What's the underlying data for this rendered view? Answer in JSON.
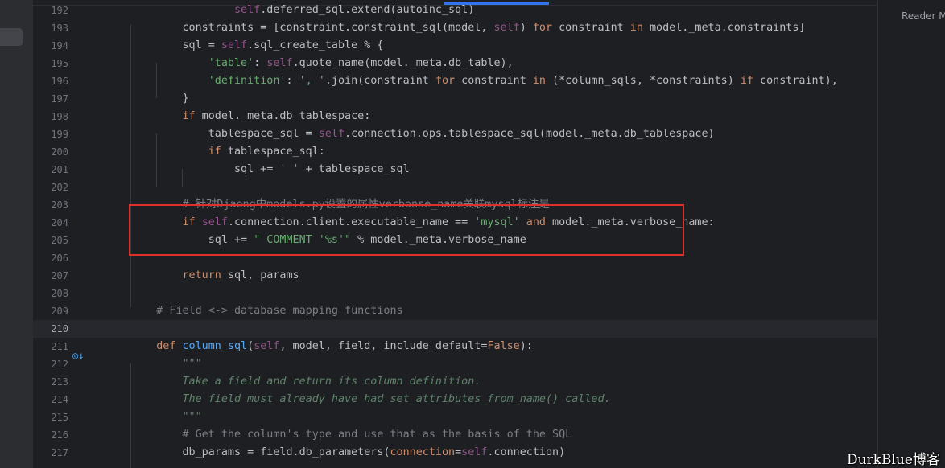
{
  "right_panel": {
    "reader_mode_label": "Reader M"
  },
  "watermark": "DurkBlue博客",
  "colors": {
    "keyword": "#cf8e6d",
    "self": "#94558d",
    "string": "#6aab73",
    "comment": "#7a7e85",
    "docstring": "#5f826b",
    "function": "#56a8f5",
    "highlight_border": "#e0302c"
  },
  "gutter_icon": "override-method-icon",
  "editor": {
    "current_line": 210,
    "lines": [
      {
        "n": "192",
        "segs": [
          [
            "",
            "                "
          ],
          [
            "self",
            "self"
          ],
          [
            "",
            ".deferred_sql.extend(autoinc_sql)"
          ]
        ]
      },
      {
        "n": "193",
        "segs": [
          [
            "",
            "        constraints = [constraint.constraint_sql(model, "
          ],
          [
            "self",
            "self"
          ],
          [
            "",
            ") "
          ],
          [
            "kw",
            "for"
          ],
          [
            "",
            " constraint "
          ],
          [
            "kw",
            "in"
          ],
          [
            "",
            " model._meta.constraints]"
          ]
        ]
      },
      {
        "n": "194",
        "segs": [
          [
            "",
            "        sql = "
          ],
          [
            "self",
            "self"
          ],
          [
            "",
            ".sql_create_table % {"
          ]
        ]
      },
      {
        "n": "195",
        "segs": [
          [
            "",
            "            "
          ],
          [
            "str",
            "'table'"
          ],
          [
            "",
            ": "
          ],
          [
            "self",
            "self"
          ],
          [
            "",
            ".quote_name(model._meta.db_table),"
          ]
        ]
      },
      {
        "n": "196",
        "segs": [
          [
            "",
            "            "
          ],
          [
            "str",
            "'definition'"
          ],
          [
            "",
            ": "
          ],
          [
            "str",
            "', '"
          ],
          [
            "",
            ".join(constraint "
          ],
          [
            "kw",
            "for"
          ],
          [
            "",
            " constraint "
          ],
          [
            "kw",
            "in"
          ],
          [
            "",
            " (*column_sqls, *constraints) "
          ],
          [
            "kw",
            "if"
          ],
          [
            "",
            " constraint),"
          ]
        ]
      },
      {
        "n": "197",
        "segs": [
          [
            "",
            "        }"
          ]
        ]
      },
      {
        "n": "198",
        "segs": [
          [
            "",
            "        "
          ],
          [
            "kw",
            "if"
          ],
          [
            "",
            " model._meta.db_tablespace:"
          ]
        ]
      },
      {
        "n": "199",
        "segs": [
          [
            "",
            "            tablespace_sql = "
          ],
          [
            "self",
            "self"
          ],
          [
            "",
            ".connection.ops.tablespace_sql(model._meta.db_tablespace)"
          ]
        ]
      },
      {
        "n": "200",
        "segs": [
          [
            "",
            "            "
          ],
          [
            "kw",
            "if"
          ],
          [
            "",
            " tablespace_sql:"
          ]
        ]
      },
      {
        "n": "201",
        "segs": [
          [
            "",
            "                sql += "
          ],
          [
            "str",
            "' '"
          ],
          [
            "",
            " + tablespace_sql"
          ]
        ]
      },
      {
        "n": "202",
        "segs": []
      },
      {
        "n": "203",
        "segs": [
          [
            "",
            "        "
          ],
          [
            "cmt",
            "# 针对Djaong中models.py设置的属性verbonse_name关联mysql标注是"
          ]
        ]
      },
      {
        "n": "204",
        "segs": [
          [
            "",
            "        "
          ],
          [
            "kw",
            "if"
          ],
          [
            "",
            " "
          ],
          [
            "self",
            "self"
          ],
          [
            "",
            ".connection.client.executable_name == "
          ],
          [
            "str",
            "'mysql'"
          ],
          [
            "",
            " "
          ],
          [
            "kw",
            "and"
          ],
          [
            "",
            " model._meta.verbose_name:"
          ]
        ]
      },
      {
        "n": "205",
        "segs": [
          [
            "",
            "            sql += "
          ],
          [
            "str",
            "\" COMMENT '%s'\""
          ],
          [
            "",
            " % model._meta.verbose_name"
          ]
        ]
      },
      {
        "n": "206",
        "segs": []
      },
      {
        "n": "207",
        "segs": [
          [
            "",
            "        "
          ],
          [
            "kw",
            "return"
          ],
          [
            "",
            " sql, params"
          ]
        ]
      },
      {
        "n": "208",
        "segs": []
      },
      {
        "n": "209",
        "segs": [
          [
            "",
            "    "
          ],
          [
            "cmt",
            "# Field <-> database mapping functions"
          ]
        ]
      },
      {
        "n": "210",
        "segs": []
      },
      {
        "n": "211",
        "segs": [
          [
            "",
            "    "
          ],
          [
            "kw",
            "def"
          ],
          [
            "",
            " "
          ],
          [
            "fn",
            "column_sql"
          ],
          [
            "",
            "("
          ],
          [
            "self",
            "self"
          ],
          [
            "",
            ", model, field, include_default="
          ],
          [
            "kw",
            "False"
          ],
          [
            "",
            "):"
          ]
        ]
      },
      {
        "n": "212",
        "segs": [
          [
            "",
            "        "
          ],
          [
            "doc",
            "\"\"\""
          ]
        ]
      },
      {
        "n": "213",
        "segs": [
          [
            "",
            "        "
          ],
          [
            "doc",
            "Take a field and return its column definition."
          ]
        ]
      },
      {
        "n": "214",
        "segs": [
          [
            "",
            "        "
          ],
          [
            "doc",
            "The field must already have had set_attributes_from_name() called."
          ]
        ]
      },
      {
        "n": "215",
        "segs": [
          [
            "",
            "        "
          ],
          [
            "doc",
            "\"\"\""
          ]
        ]
      },
      {
        "n": "216",
        "segs": [
          [
            "",
            "        "
          ],
          [
            "cmt",
            "# Get the column's type and use that as the basis of the SQL"
          ]
        ]
      },
      {
        "n": "217",
        "segs": [
          [
            "",
            "        db_params = field.db_parameters("
          ],
          [
            "kw",
            "connection"
          ],
          [
            "",
            "="
          ],
          [
            "self",
            "self"
          ],
          [
            "",
            ".connection)"
          ]
        ]
      }
    ]
  }
}
